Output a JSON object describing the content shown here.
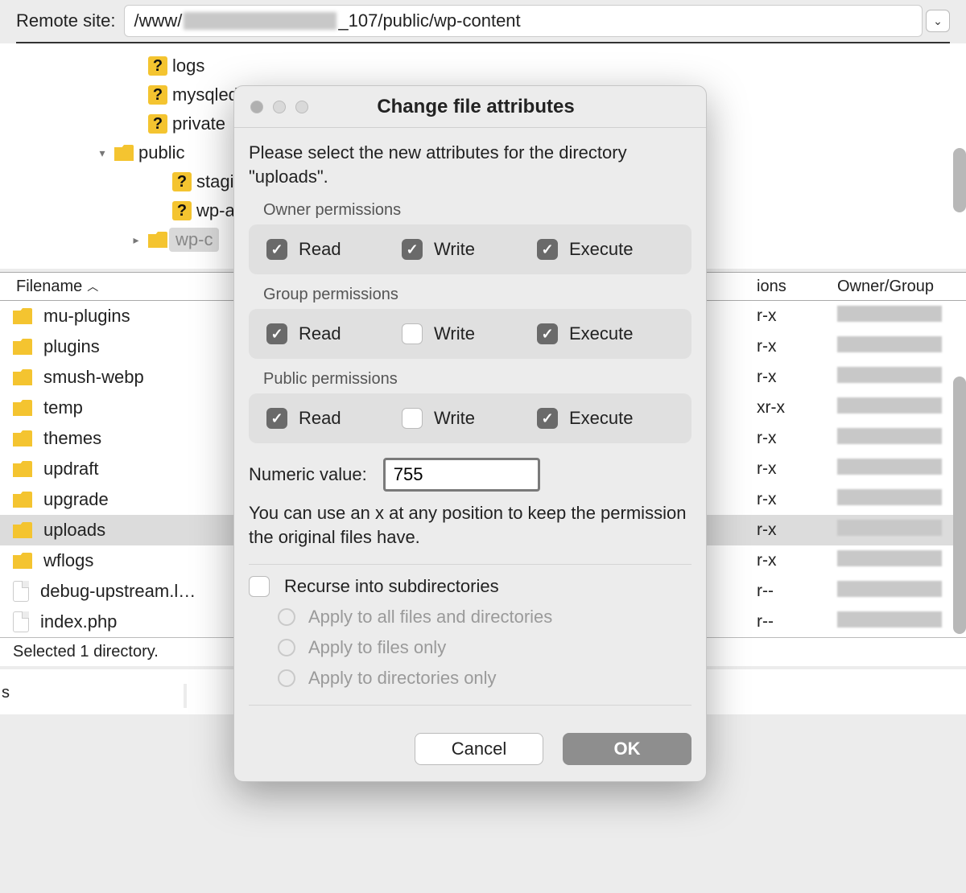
{
  "topbar": {
    "label": "Remote site:",
    "path_prefix": "/www/",
    "path_suffix": "_107/public/wp-content"
  },
  "tree": {
    "items": [
      {
        "depth": 1,
        "icon": "q",
        "label": "logs"
      },
      {
        "depth": 1,
        "icon": "q",
        "label": "mysqled"
      },
      {
        "depth": 1,
        "icon": "q",
        "label": "private"
      },
      {
        "depth": 1,
        "icon": "folder",
        "label": "public",
        "expander": "▾"
      },
      {
        "depth": 2,
        "icon": "q",
        "label": "stagi"
      },
      {
        "depth": 2,
        "icon": "q",
        "label": "wp-a"
      },
      {
        "depth": 2,
        "icon": "folder-open",
        "label": "wp-c",
        "expander": "▸",
        "selected": true
      }
    ]
  },
  "table": {
    "columns": {
      "filename": "Filename",
      "permissions": "ions",
      "owner": "Owner/Group"
    },
    "rows": [
      {
        "icon": "folder",
        "name": "mu-plugins",
        "perm": "r-x"
      },
      {
        "icon": "folder",
        "name": "plugins",
        "perm": "r-x"
      },
      {
        "icon": "folder",
        "name": "smush-webp",
        "perm": "r-x"
      },
      {
        "icon": "folder",
        "name": "temp",
        "perm": "xr-x"
      },
      {
        "icon": "folder",
        "name": "themes",
        "perm": "r-x"
      },
      {
        "icon": "folder",
        "name": "updraft",
        "perm": "r-x"
      },
      {
        "icon": "folder",
        "name": "upgrade",
        "perm": "r-x"
      },
      {
        "icon": "folder",
        "name": "uploads",
        "perm": "r-x",
        "selected": true
      },
      {
        "icon": "folder",
        "name": "wflogs",
        "perm": "r-x"
      },
      {
        "icon": "file",
        "name": "debug-upstream.l…",
        "perm": "r--"
      },
      {
        "icon": "file",
        "name": "index.php",
        "perm": "r--"
      }
    ],
    "status": "Selected 1 directory."
  },
  "dialog": {
    "title": "Change file attributes",
    "prompt": "Please select the new attributes for the directory \"uploads\".",
    "groups": {
      "owner": {
        "label": "Owner permissions",
        "read": true,
        "write": true,
        "execute": true
      },
      "group": {
        "label": "Group permissions",
        "read": true,
        "write": false,
        "execute": true
      },
      "public": {
        "label": "Public permissions",
        "read": true,
        "write": false,
        "execute": true
      }
    },
    "perm_labels": {
      "read": "Read",
      "write": "Write",
      "execute": "Execute"
    },
    "numeric": {
      "label": "Numeric value:",
      "value": "755"
    },
    "hint": "You can use an x at any position to keep the permission the original files have.",
    "recurse": {
      "label": "Recurse into subdirectories",
      "checked": false
    },
    "recurse_options": {
      "all": "Apply to all files and directories",
      "files": "Apply to files only",
      "dirs": "Apply to directories only"
    },
    "buttons": {
      "cancel": "Cancel",
      "ok": "OK"
    }
  },
  "bottom": {
    "s": "s"
  }
}
